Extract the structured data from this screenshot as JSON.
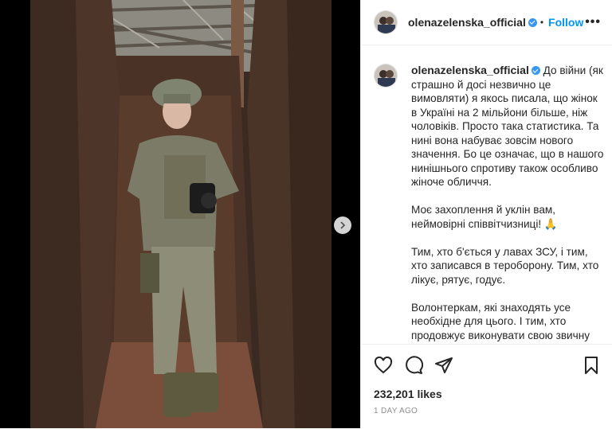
{
  "user": {
    "username": "olenazelenska_official",
    "verified": true
  },
  "header": {
    "separator": "•",
    "follow_label": "Follow",
    "more_label": "•••"
  },
  "caption": {
    "username": "olenazelenska_official",
    "paragraphs": [
      "До війни (як страшно й досі незвично це вимовляти) я якось писала, що жінок в Україні на 2 мільйони більше, ніж чоловіків. Просто така статистика. Та нині вона набуває зовсім нового значення. Бо це означає, що в нашого нинішнього спротиву також особливо жіноче обличчя.",
      "Моє захоплення й уклін вам, неймовірні співвітчизниці! 🙏",
      "Тим, хто б'ється у лавах ЗСУ, і тим, хто записався в тероборону. Тим, хто лікує, рятує, годує.",
      "Волонтеркам, які знаходять усе необхідне для цього. І тим, хто продовжує виконувати свою звичну роботу – в аптеках, крамницях, на"
    ]
  },
  "actions": {
    "icons": [
      "heart-icon",
      "comment-icon",
      "share-icon",
      "bookmark-icon"
    ]
  },
  "stats": {
    "likes": "232,201 likes",
    "time": "1 DAY AGO"
  },
  "media": {
    "description_icon": "chevron-right-icon"
  },
  "colors": {
    "accent": "#0095f6",
    "verified": "#3897f0",
    "text": "#262626",
    "muted": "#8e8e8e"
  }
}
